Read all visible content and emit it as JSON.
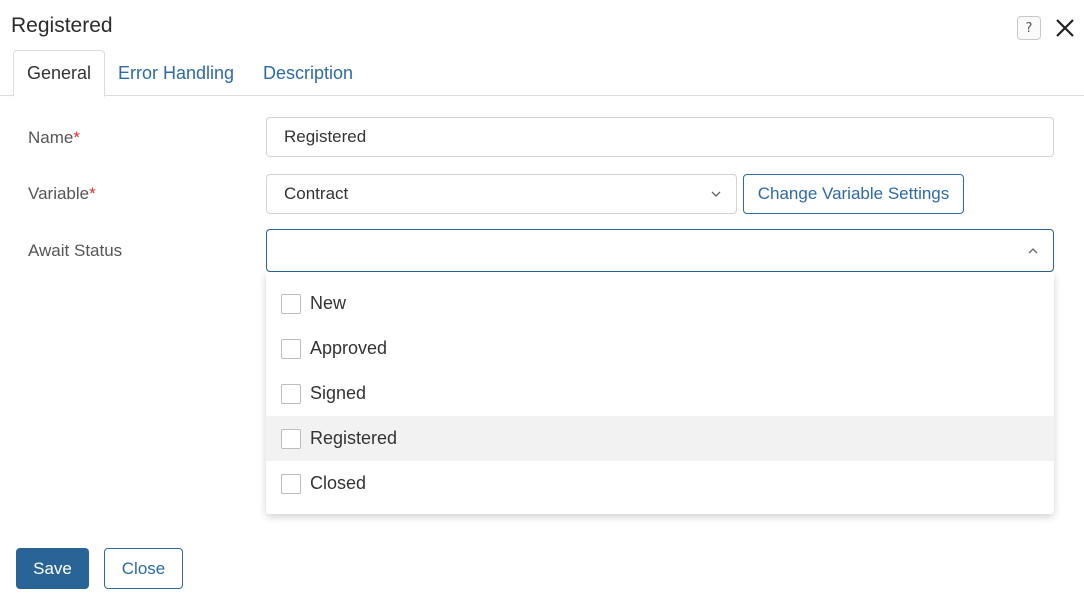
{
  "dialog": {
    "title": "Registered",
    "help_label": "?"
  },
  "tabs": [
    {
      "label": "General",
      "active": true
    },
    {
      "label": "Error Handling",
      "active": false
    },
    {
      "label": "Description",
      "active": false
    }
  ],
  "form": {
    "name_label": "Name",
    "required_mark": "*",
    "name_value": "Registered",
    "variable_label": "Variable",
    "variable_value": "Contract",
    "change_variable_label": "Change Variable Settings",
    "await_status_label": "Await Status",
    "await_status_value": ""
  },
  "status_options": [
    {
      "label": "New",
      "checked": false
    },
    {
      "label": "Approved",
      "checked": false
    },
    {
      "label": "Signed",
      "checked": false
    },
    {
      "label": "Registered",
      "checked": false,
      "hovered": true
    },
    {
      "label": "Closed",
      "checked": false
    }
  ],
  "footer": {
    "save_label": "Save",
    "close_label": "Close"
  },
  "colors": {
    "accent": "#2e6aa3",
    "primary_button": "#2a6496",
    "required": "#d9342b",
    "focus_border": "#2a6496"
  }
}
